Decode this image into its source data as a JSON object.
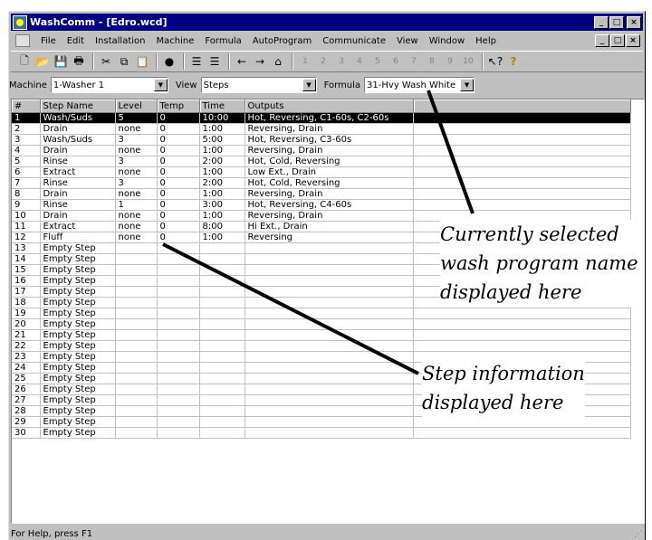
{
  "window": {
    "title": "WashComm - [Edro.wcd]",
    "buttons": {
      "minimize": "_",
      "maximize": "□",
      "close": "×"
    }
  },
  "menu": [
    "File",
    "Edit",
    "Installation",
    "Machine",
    "Formula",
    "AutoProgram",
    "Communicate",
    "View",
    "Window",
    "Help"
  ],
  "toolbar": {
    "program_buttons": [
      "1",
      "2",
      "3",
      "4",
      "5",
      "6",
      "7",
      "8",
      "9",
      "10"
    ]
  },
  "selectors": {
    "machine_label": "Machine",
    "machine_value": "1-Washer 1",
    "view_label": "View",
    "view_value": "Steps",
    "formula_label": "Formula",
    "formula_value": "31-Hvy Wash White"
  },
  "grid": {
    "headers": [
      "#",
      "Step Name",
      "Level",
      "Temp",
      "Time",
      "Outputs"
    ],
    "selected_row": 0,
    "rows": [
      [
        "1",
        "Wash/Suds",
        "5",
        "0",
        "10:00",
        "Hot, Reversing, C1-60s, C2-60s"
      ],
      [
        "2",
        "Drain",
        "none",
        "0",
        "1:00",
        "Reversing, Drain"
      ],
      [
        "3",
        "Wash/Suds",
        "3",
        "0",
        "5:00",
        "Hot, Reversing, C3-60s"
      ],
      [
        "4",
        "Drain",
        "none",
        "0",
        "1:00",
        "Reversing, Drain"
      ],
      [
        "5",
        "Rinse",
        "3",
        "0",
        "2:00",
        "Hot, Cold, Reversing"
      ],
      [
        "6",
        "Extract",
        "none",
        "0",
        "1:00",
        "Low Ext., Drain"
      ],
      [
        "7",
        "Rinse",
        "3",
        "0",
        "2:00",
        "Hot, Cold, Reversing"
      ],
      [
        "8",
        "Drain",
        "none",
        "0",
        "1:00",
        "Reversing, Drain"
      ],
      [
        "9",
        "Rinse",
        "1",
        "0",
        "3:00",
        "Hot, Reversing, C4-60s"
      ],
      [
        "10",
        "Drain",
        "none",
        "0",
        "1:00",
        "Reversing, Drain"
      ],
      [
        "11",
        "Extract",
        "none",
        "0",
        "8:00",
        "Hi Ext., Drain"
      ],
      [
        "12",
        "Fluff",
        "none",
        "0",
        "1:00",
        "Reversing"
      ],
      [
        "13",
        "Empty Step",
        "",
        "",
        "",
        ""
      ],
      [
        "14",
        "Empty Step",
        "",
        "",
        "",
        ""
      ],
      [
        "15",
        "Empty Step",
        "",
        "",
        "",
        ""
      ],
      [
        "16",
        "Empty Step",
        "",
        "",
        "",
        ""
      ],
      [
        "17",
        "Empty Step",
        "",
        "",
        "",
        ""
      ],
      [
        "18",
        "Empty Step",
        "",
        "",
        "",
        ""
      ],
      [
        "19",
        "Empty Step",
        "",
        "",
        "",
        ""
      ],
      [
        "20",
        "Empty Step",
        "",
        "",
        "",
        ""
      ],
      [
        "21",
        "Empty Step",
        "",
        "",
        "",
        ""
      ],
      [
        "22",
        "Empty Step",
        "",
        "",
        "",
        ""
      ],
      [
        "23",
        "Empty Step",
        "",
        "",
        "",
        ""
      ],
      [
        "24",
        "Empty Step",
        "",
        "",
        "",
        ""
      ],
      [
        "25",
        "Empty Step",
        "",
        "",
        "",
        ""
      ],
      [
        "26",
        "Empty Step",
        "",
        "",
        "",
        ""
      ],
      [
        "27",
        "Empty Step",
        "",
        "",
        "",
        ""
      ],
      [
        "28",
        "Empty Step",
        "",
        "",
        "",
        ""
      ],
      [
        "29",
        "Empty Step",
        "",
        "",
        "",
        ""
      ],
      [
        "30",
        "Empty Step",
        "",
        "",
        "",
        ""
      ]
    ]
  },
  "status": "For Help, press F1",
  "annotations": {
    "program": [
      "Currently selected",
      "wash program name",
      "displayed here"
    ],
    "steps": [
      "Step information",
      "displayed here"
    ]
  }
}
